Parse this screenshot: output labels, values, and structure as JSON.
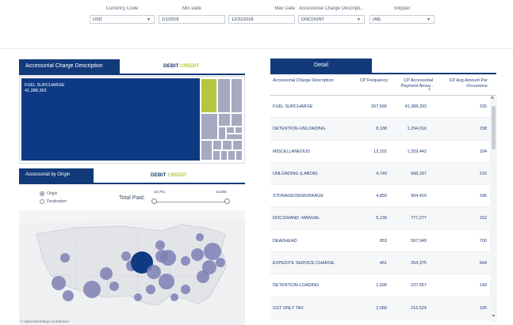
{
  "filters": {
    "currency_code": {
      "label": "Currency Code",
      "value": "USD"
    },
    "min_date": {
      "label": "Min Date",
      "value": "1/1/2018"
    },
    "max_date": {
      "label": "Max Date",
      "value": "12/31/2018"
    },
    "accessorial_charge": {
      "label": "Accessorial Charge Descripti...",
      "value": "DISCOUNT"
    },
    "shipper": {
      "label": "Shipper",
      "value": "(All)"
    }
  },
  "left_panel": {
    "tab1_label": "Accessorial Charge Description",
    "debit_label": "DEBIT",
    "credit_label": "CREDIT",
    "treemap_label": "FUEL SURCHARGE",
    "treemap_value": "41,388,393",
    "tab2_label": "Accessorial by Origin",
    "radio_origin": "Origin",
    "radio_destination": "Destination",
    "total_paid_label": "Total Paid:",
    "slider_min": "-10,791",
    "slider_max": "15,605",
    "map_attribution": "© OpenStreetMap contributors"
  },
  "right_panel": {
    "tab_label": "Detail",
    "columns": [
      "Accessorial Charge Description",
      "CP Frequency",
      "CP Accessorial Payment Amou..",
      "CP Avg Amount Per Occurence"
    ],
    "rows": [
      [
        "FUEL SURCHARGE",
        "267,566",
        "41,388,393",
        "155"
      ],
      [
        "DETENTION-UNLOADING",
        "8,188",
        "1,294,016",
        "158"
      ],
      [
        "MISCELLANEOUS",
        "12,101",
        "1,259,442",
        "104"
      ],
      [
        "UNLOADING (LABOR)",
        "4,749",
        "998,297",
        "210"
      ],
      [
        "STORAGE/DEMURRAGE",
        "4,850",
        "904,410",
        "186"
      ],
      [
        "DOCS/HAND -MANUAL",
        "5,130",
        "777,277",
        "152"
      ],
      [
        "DEADHEAD",
        "853",
        "597,049",
        "700"
      ],
      [
        "EXPEDITE SERVICE CHARGE",
        "451",
        "254,375",
        "564"
      ],
      [
        "DETENTION-LOADING",
        "1,696",
        "237,557",
        "140"
      ],
      [
        "GST ONLY TAX",
        "2,066",
        "216,524",
        "105"
      ]
    ]
  },
  "colors": {
    "navy": "#123a7a",
    "treemap_main": "#0d3a83",
    "treemap_cell": "#a7a9c1",
    "treemap_lime": "#b7c73d",
    "map_circle": "#7c7fb4",
    "map_circle_dark": "#0d3a83"
  }
}
